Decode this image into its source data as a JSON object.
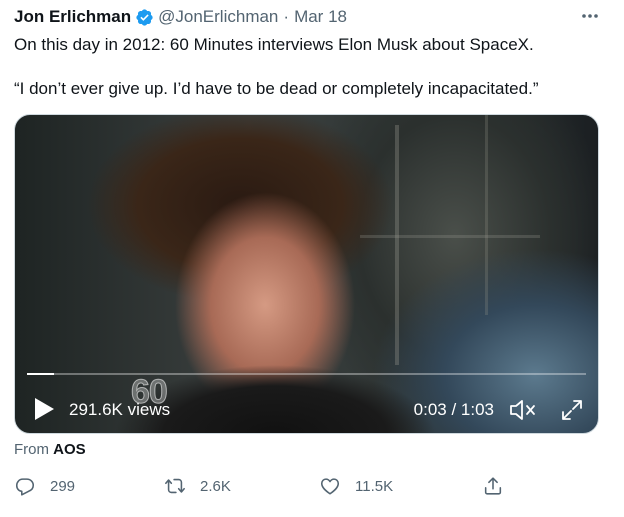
{
  "tweet": {
    "author_name": "Jon Erlichman",
    "handle": "@JonErlichman",
    "separator": "·",
    "date": "Mar 18",
    "text_lines": [
      "On this day in 2012: 60 Minutes interviews Elon Musk about SpaceX.",
      "“I don’t ever give up. I’d have to be dead or completely incapacitated.”"
    ],
    "source_prefix": "From",
    "source": "AOS"
  },
  "video": {
    "views": "291.6K views",
    "time": "0:03 / 1:03",
    "watermark": "60",
    "progress_fraction": 0.048
  },
  "actions": {
    "reply_count": "299",
    "retweet_count": "2.6K",
    "like_count": "11.5K"
  },
  "icons": {
    "verified": "verified-badge-icon",
    "more": "more-options-icon",
    "play": "play-icon",
    "mute": "muted-speaker-icon",
    "expand": "expand-icon",
    "reply": "reply-icon",
    "retweet": "retweet-icon",
    "like": "heart-icon",
    "share": "share-icon"
  },
  "colors": {
    "verified": "#1d9bf0",
    "muted_text": "#536471",
    "primary_text": "#0f1419"
  }
}
